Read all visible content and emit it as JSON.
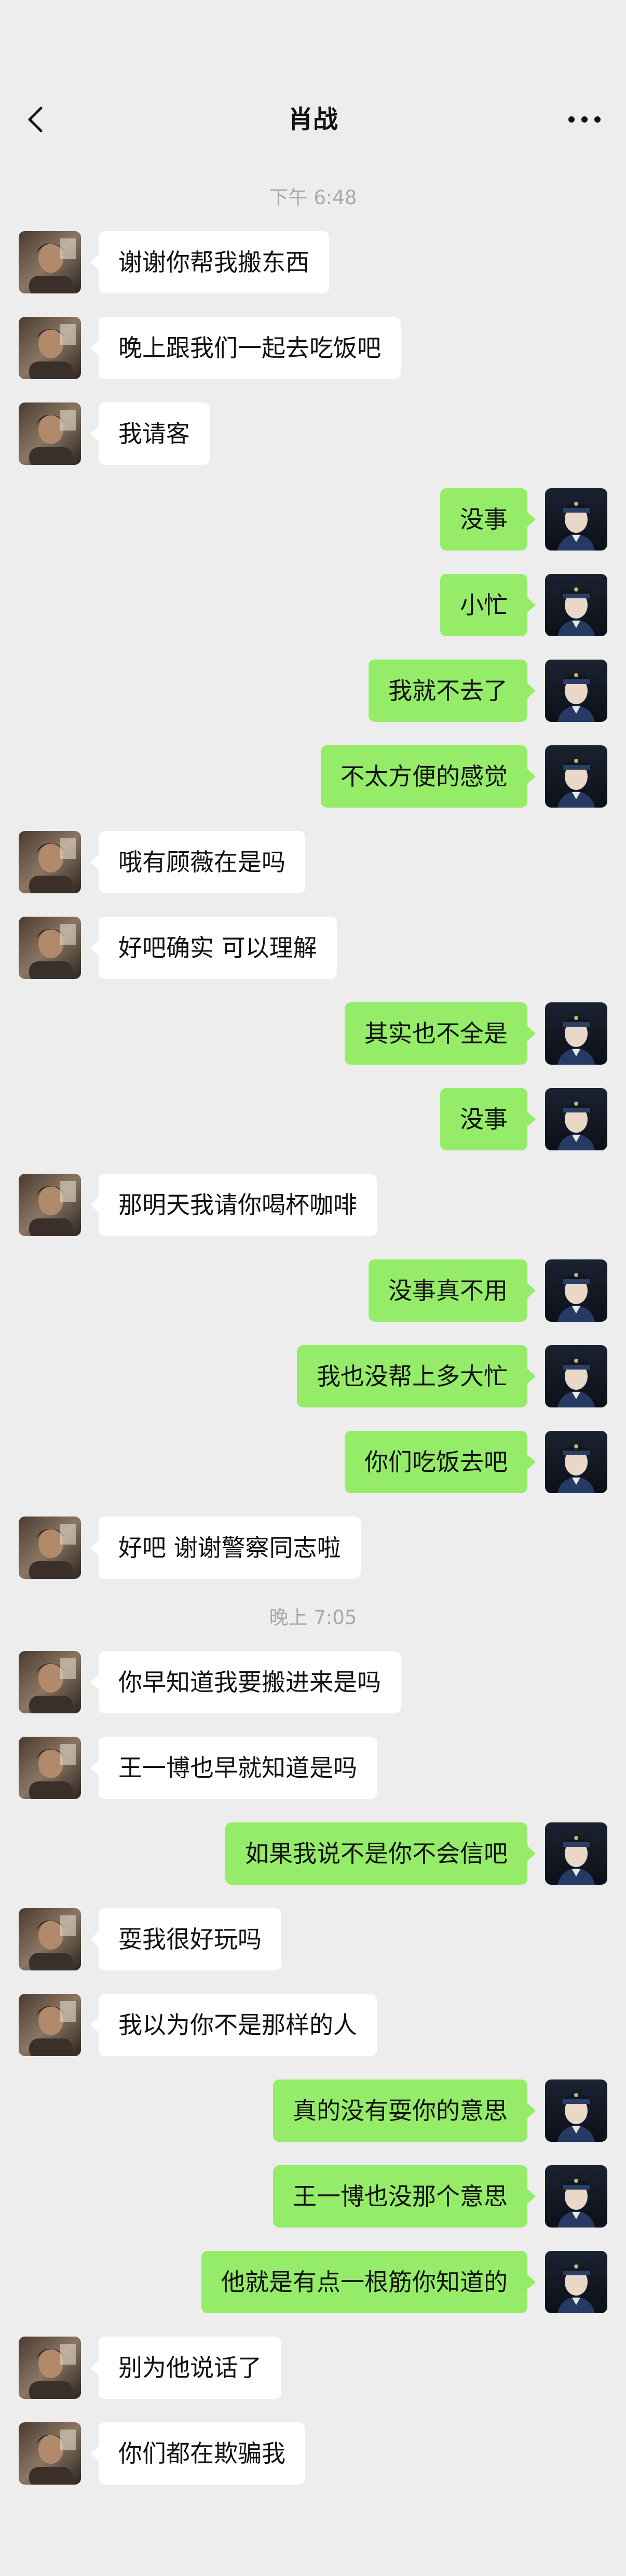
{
  "header": {
    "title": "肖战",
    "back_icon": "chevron-left-icon",
    "more_icon": "more-horizontal-icon"
  },
  "colors": {
    "background": "#ededed",
    "sent_bubble": "#95ec69",
    "received_bubble": "#ffffff",
    "timestamp_text": "#a8a8a8"
  },
  "messages": [
    {
      "type": "time",
      "text": "下午 6:48"
    },
    {
      "type": "msg",
      "side": "left",
      "text": "谢谢你帮我搬东西"
    },
    {
      "type": "msg",
      "side": "left",
      "text": "晚上跟我们一起去吃饭吧"
    },
    {
      "type": "msg",
      "side": "left",
      "text": "我请客"
    },
    {
      "type": "msg",
      "side": "right",
      "text": "没事"
    },
    {
      "type": "msg",
      "side": "right",
      "text": "小忙"
    },
    {
      "type": "msg",
      "side": "right",
      "text": "我就不去了"
    },
    {
      "type": "msg",
      "side": "right",
      "text": "不太方便的感觉"
    },
    {
      "type": "msg",
      "side": "left",
      "text": "哦有顾薇在是吗"
    },
    {
      "type": "msg",
      "side": "left",
      "text": "好吧确实 可以理解"
    },
    {
      "type": "msg",
      "side": "right",
      "text": "其实也不全是"
    },
    {
      "type": "msg",
      "side": "right",
      "text": "没事"
    },
    {
      "type": "msg",
      "side": "left",
      "text": "那明天我请你喝杯咖啡"
    },
    {
      "type": "msg",
      "side": "right",
      "text": "没事真不用"
    },
    {
      "type": "msg",
      "side": "right",
      "text": "我也没帮上多大忙"
    },
    {
      "type": "msg",
      "side": "right",
      "text": "你们吃饭去吧"
    },
    {
      "type": "msg",
      "side": "left",
      "text": "好吧 谢谢警察同志啦"
    },
    {
      "type": "time",
      "text": "晚上 7:05"
    },
    {
      "type": "msg",
      "side": "left",
      "text": "你早知道我要搬进来是吗"
    },
    {
      "type": "msg",
      "side": "left",
      "text": "王一博也早就知道是吗"
    },
    {
      "type": "msg",
      "side": "right",
      "text": "如果我说不是你不会信吧"
    },
    {
      "type": "msg",
      "side": "left",
      "text": "耍我很好玩吗"
    },
    {
      "type": "msg",
      "side": "left",
      "text": "我以为你不是那样的人"
    },
    {
      "type": "msg",
      "side": "right",
      "text": "真的没有耍你的意思"
    },
    {
      "type": "msg",
      "side": "right",
      "text": "王一博也没那个意思"
    },
    {
      "type": "msg",
      "side": "right",
      "text": "他就是有点一根筋你知道的"
    },
    {
      "type": "msg",
      "side": "left",
      "text": "别为他说话了"
    },
    {
      "type": "msg",
      "side": "left",
      "text": "你们都在欺骗我"
    }
  ]
}
